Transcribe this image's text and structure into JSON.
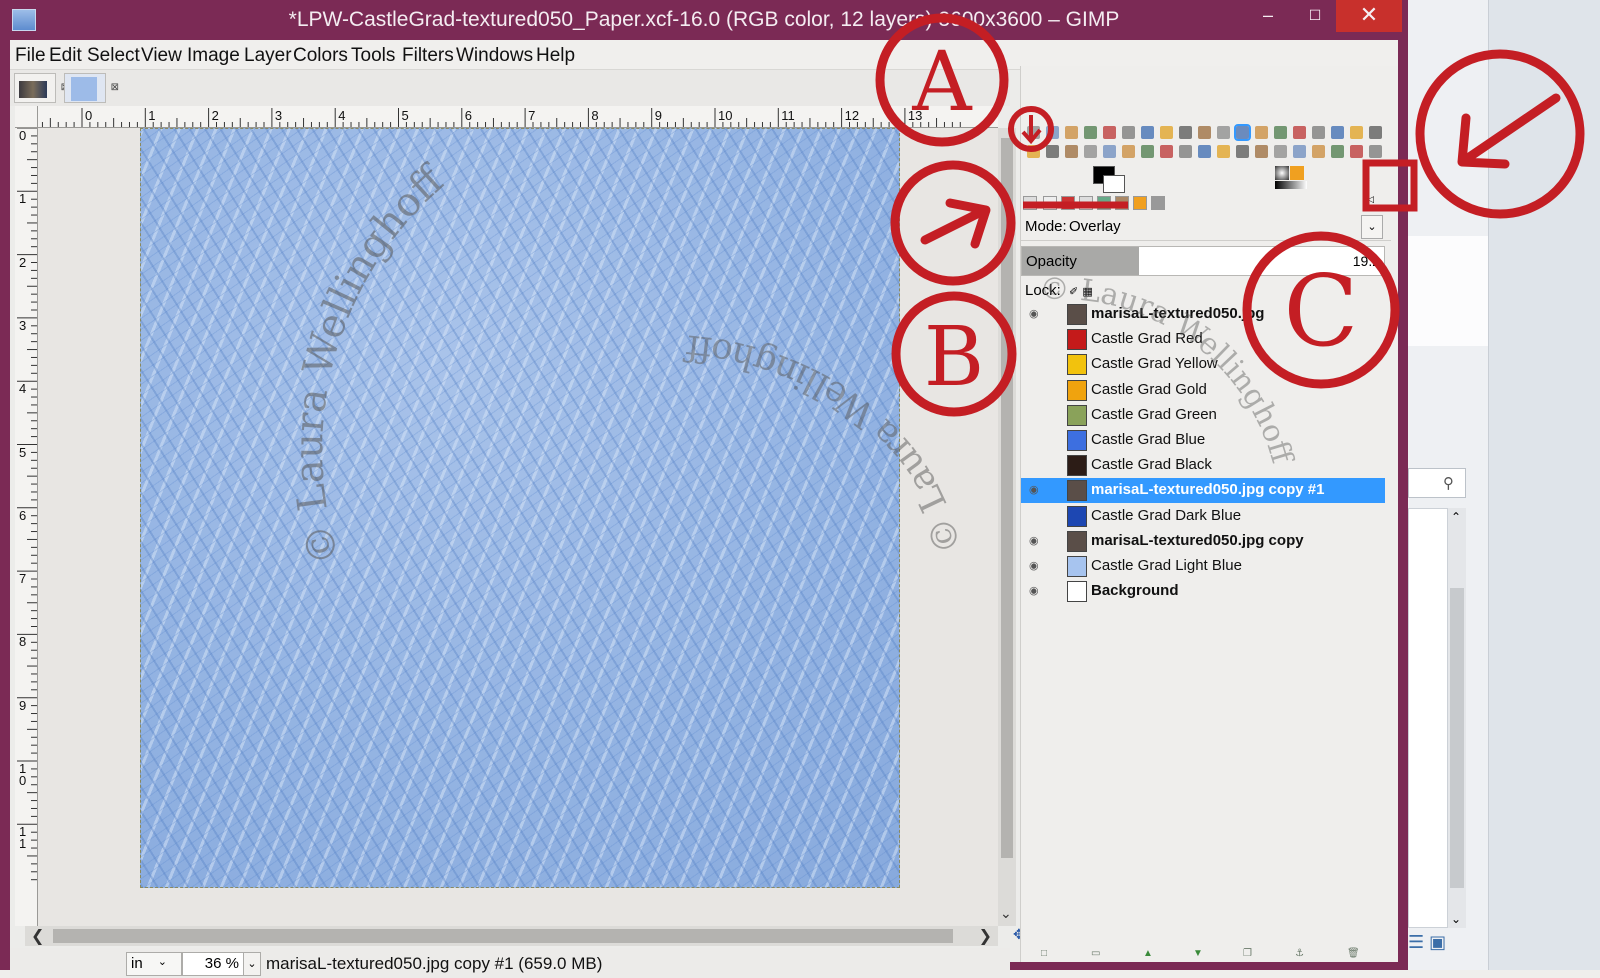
{
  "window": {
    "title": "*LPW-CastleGrad-textured050_Paper.xcf-16.0 (RGB color, 12 layers) 3600x3600 – GIMP",
    "minimize": "–",
    "maximize": "☐",
    "close": "✕"
  },
  "menubar": {
    "items": [
      "File",
      "Edit",
      "Select",
      "View",
      "Image",
      "Layer",
      "Colors",
      "Tools",
      "Filters",
      "Windows",
      "Help"
    ]
  },
  "image_tabs": {
    "close_glyph": "⊠"
  },
  "rulers": {
    "horizontal": [
      "1",
      "0",
      "1",
      "2",
      "3",
      "4",
      "5",
      "6",
      "7",
      "8",
      "9",
      "10",
      "11",
      "12",
      "13"
    ],
    "vertical": [
      "0",
      "1",
      "2",
      "3",
      "4",
      "5",
      "6",
      "7",
      "8",
      "9",
      "10",
      "11"
    ]
  },
  "statusbar": {
    "unit": "in",
    "zoom": "36 %",
    "message": "marisaL-textured050.jpg copy #1 (659.0 MB)"
  },
  "layers_panel": {
    "mode_label": "Mode:",
    "mode_value": "Overlay",
    "opacity_label": "Opacity",
    "opacity_value": "19.2",
    "opacity_fraction": 0.192,
    "lock_label": "Lock:",
    "layers": [
      {
        "name": "marisaL-textured050.jpg",
        "color": "#5a4e48",
        "visible": true,
        "bold": true
      },
      {
        "name": "Castle Grad Red",
        "color": "#c41a1a",
        "visible": false,
        "bold": false
      },
      {
        "name": "Castle Grad Yellow",
        "color": "#f2c20d",
        "visible": false,
        "bold": false
      },
      {
        "name": "Castle Grad Gold",
        "color": "#f0a30e",
        "visible": false,
        "bold": false
      },
      {
        "name": "Castle Grad Green",
        "color": "#8aa25a",
        "visible": false,
        "bold": false
      },
      {
        "name": "Castle Grad Blue",
        "color": "#3d6fe0",
        "visible": false,
        "bold": false
      },
      {
        "name": "Castle Grad Black",
        "color": "#2c1c16",
        "visible": false,
        "bold": false
      },
      {
        "name": "marisaL-textured050.jpg copy #1",
        "color": "#5a4e48",
        "visible": true,
        "bold": true,
        "selected": true
      },
      {
        "name": "Castle Grad Dark Blue",
        "color": "#1d47b2",
        "visible": false,
        "bold": false
      },
      {
        "name": "marisaL-textured050.jpg copy",
        "color": "#5a4e48",
        "visible": true,
        "bold": true
      },
      {
        "name": "Castle Grad Light Blue",
        "color": "#a7c4ef",
        "visible": true,
        "bold": false
      },
      {
        "name": "Background",
        "color": "#ffffff",
        "visible": true,
        "bold": true
      }
    ]
  },
  "annotations": {
    "a": "A",
    "b": "B",
    "c": "C"
  },
  "watermark": {
    "text": "© Laura Wellinghoff"
  },
  "colors": {
    "title_bar": "#7b2a55",
    "close_button": "#c8302c",
    "selection": "#3399ff",
    "annotation_red": "#c41e24"
  }
}
